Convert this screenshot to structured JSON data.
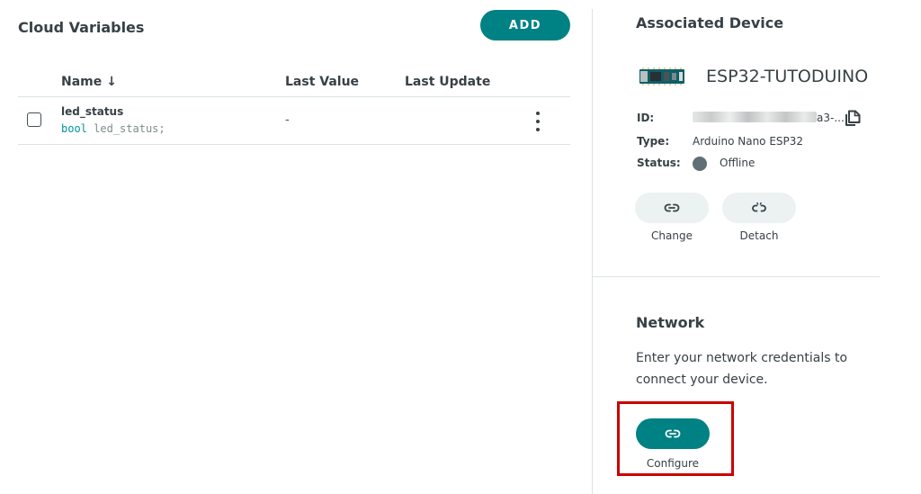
{
  "cloud_variables": {
    "title": "Cloud Variables",
    "add_label": "ADD",
    "columns": {
      "name": "Name",
      "sort_arrow": "↓",
      "last_value": "Last Value",
      "last_update": "Last Update"
    },
    "rows": [
      {
        "name": "led_status",
        "type_keyword": "bool",
        "declaration": "led_status;",
        "last_value": "-",
        "last_update": ""
      }
    ]
  },
  "device": {
    "title": "Associated Device",
    "name": "ESP32-TUTODUINO",
    "id_label": "ID:",
    "id_visible_suffix": "a3-...",
    "type_label": "Type:",
    "type_value": "Arduino Nano ESP32",
    "status_label": "Status:",
    "status_value": "Offline",
    "change_label": "Change",
    "detach_label": "Detach"
  },
  "network": {
    "title": "Network",
    "description": "Enter your network credentials to connect your device.",
    "configure_label": "Configure"
  },
  "colors": {
    "accent": "#008184",
    "highlight": "#cc0000",
    "status_offline": "#626f75"
  }
}
